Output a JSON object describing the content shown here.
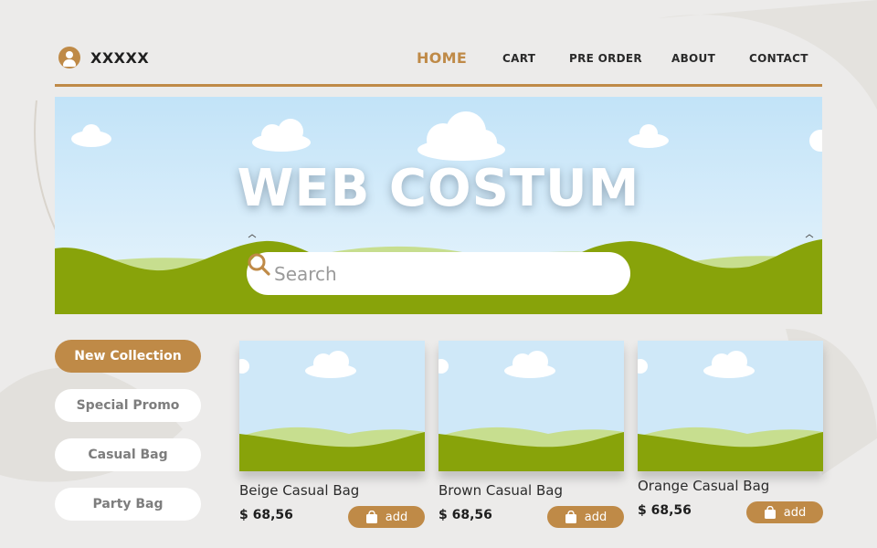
{
  "brand": {
    "name": "XXXXX",
    "icon": "user-icon"
  },
  "nav": {
    "items": [
      {
        "label": "HOME",
        "active": true
      },
      {
        "label": "CART",
        "active": false
      },
      {
        "label": "PRE ORDER",
        "active": false
      },
      {
        "label": "ABOUT",
        "active": false
      },
      {
        "label": "CONTACT",
        "active": false
      }
    ]
  },
  "hero": {
    "title": "WEB COSTUM",
    "search_placeholder": "Search",
    "search_value": ""
  },
  "sidebar": {
    "items": [
      {
        "label": "New Collection",
        "active": true
      },
      {
        "label": "Special Promo",
        "active": false
      },
      {
        "label": "Casual Bag",
        "active": false
      },
      {
        "label": "Party Bag",
        "active": false
      }
    ]
  },
  "products": [
    {
      "name": "Beige Casual Bag",
      "price": "$ 68,56",
      "add_label": "add"
    },
    {
      "name": "Brown Casual Bag",
      "price": "$ 68,56",
      "add_label": "add"
    },
    {
      "name": "Orange Casual Bag",
      "price": "$ 68,56",
      "add_label": "add"
    }
  ],
  "colors": {
    "accent": "#bf8a47",
    "sky": "#cfe8f8",
    "grass": "#88a30a",
    "grass_light": "#c7de8f",
    "background": "#ecebea"
  }
}
